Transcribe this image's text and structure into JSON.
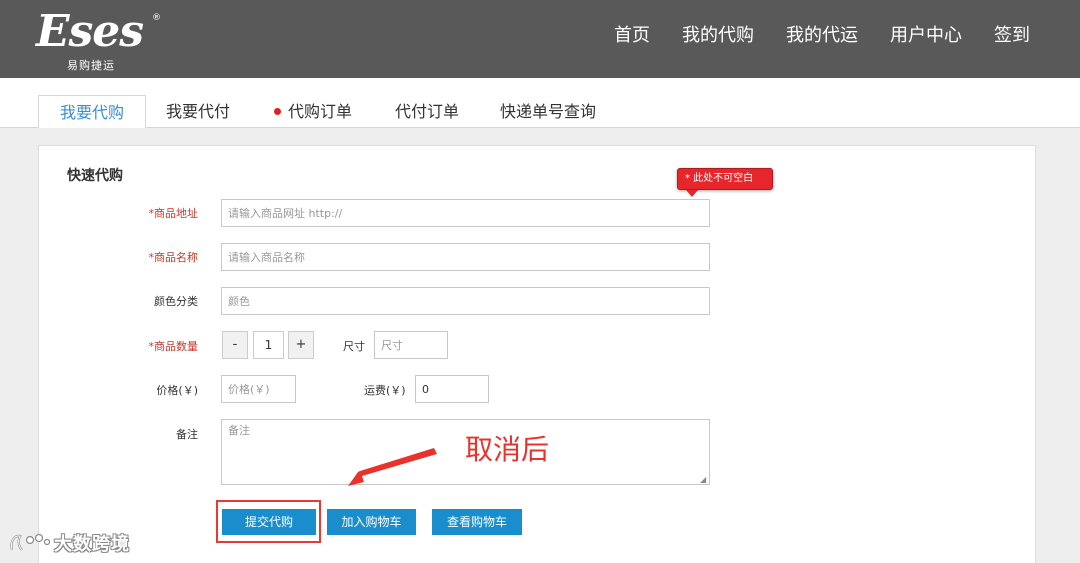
{
  "brand": {
    "logo_text": "Eses",
    "registered_mark": "®",
    "subtitle": "易购捷运"
  },
  "nav": {
    "items": [
      {
        "label": "首页"
      },
      {
        "label": "我的代购"
      },
      {
        "label": "我的代运"
      },
      {
        "label": "用户中心"
      },
      {
        "label": "签到"
      }
    ]
  },
  "tabs": [
    {
      "label": "我要代购",
      "active": true
    },
    {
      "label": "我要代付",
      "active": false
    },
    {
      "label": "代购订单",
      "active": false,
      "has_dot": true
    },
    {
      "label": "代付订单",
      "active": false
    },
    {
      "label": "快递单号查询",
      "active": false
    }
  ],
  "form": {
    "section_title": "快速代购",
    "required_mark": "*",
    "url": {
      "label": "商品地址",
      "placeholder": "请输入商品网址 http://",
      "value": ""
    },
    "name": {
      "label": "商品名称",
      "placeholder": "请输入商品名称",
      "value": ""
    },
    "color": {
      "label": "颜色分类",
      "placeholder": "颜色",
      "value": ""
    },
    "quantity": {
      "label": "商品数量",
      "minus": "-",
      "value": "1",
      "plus": "+"
    },
    "size": {
      "label": "尺寸",
      "placeholder": "尺寸",
      "value": ""
    },
    "price": {
      "label": "价格(￥)",
      "placeholder": "价格(￥)",
      "value": ""
    },
    "shipping": {
      "label": "运费(￥)",
      "value": "0"
    },
    "notes": {
      "label": "备注",
      "placeholder": "备注",
      "value": ""
    },
    "tooltip": "* 此处不可空白"
  },
  "buttons": {
    "submit": "提交代购",
    "add_to_cart": "加入购物车",
    "view_cart": "查看购物车"
  },
  "annotation": {
    "text": "取消后"
  },
  "watermark": {
    "text": "大数跨境"
  },
  "colors": {
    "header_bg": "#595959",
    "accent_blue": "#1a8dcc",
    "tab_active": "#3a8fd0",
    "error_red": "#e7262b",
    "annotation_red": "#e8322c"
  }
}
